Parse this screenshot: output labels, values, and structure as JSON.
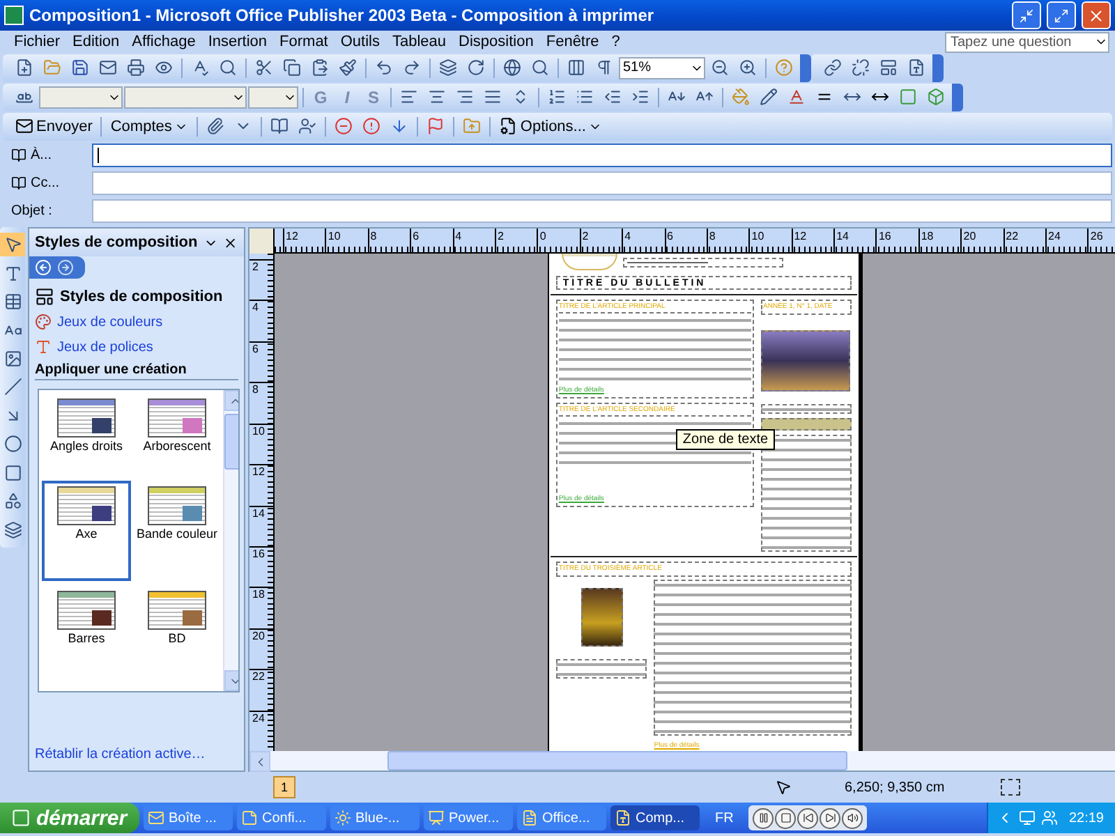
{
  "window": {
    "title": "Composition1 - Microsoft Office Publisher 2003 Beta - Composition à imprimer"
  },
  "menu": [
    "Fichier",
    "Edition",
    "Affichage",
    "Insertion",
    "Format",
    "Outils",
    "Tableau",
    "Disposition",
    "Fenêtre",
    "?"
  ],
  "help_search": {
    "placeholder": "Tapez une question"
  },
  "standard_toolbar": {
    "zoom": "51%"
  },
  "format_toolbar": {
    "style_buttons": [
      "G",
      "I",
      "S"
    ]
  },
  "mail_toolbar": {
    "send": "Envoyer",
    "accounts": "Comptes",
    "options": "Options..."
  },
  "address_fields": [
    {
      "label": "À...",
      "focused": true
    },
    {
      "label": "Cc...",
      "focused": false
    },
    {
      "label": "Objet :",
      "focused": false
    }
  ],
  "task_pane": {
    "title": "Styles de composition",
    "heading": "Styles de composition",
    "links": [
      "Jeux de couleurs",
      "Jeux de polices"
    ],
    "section": "Appliquer une création",
    "designs": [
      {
        "name": "Angles droits",
        "selected": false
      },
      {
        "name": "Arborescent",
        "selected": false
      },
      {
        "name": "Axe",
        "selected": true
      },
      {
        "name": "Bande couleur",
        "selected": false
      },
      {
        "name": "Barres",
        "selected": false
      },
      {
        "name": "BD",
        "selected": false
      }
    ],
    "footer_link": "Rétablir la création active…"
  },
  "rulers": {
    "horizontal": [
      "12",
      "10",
      "8",
      "6",
      "4",
      "2",
      "0",
      "2",
      "4",
      "6",
      "8",
      "10",
      "12",
      "14",
      "16",
      "18",
      "20",
      "22",
      "24",
      "26"
    ],
    "vertical": [
      "2",
      "4",
      "6",
      "8",
      "10",
      "12",
      "14",
      "16",
      "18",
      "20",
      "22",
      "24"
    ]
  },
  "publication": {
    "title": "TITRE DU BULLETIN",
    "date": "ANNÉE 1, N° 1, DATE",
    "main_heading": "TITRE DE L'ARTICLE PRINCIPAL",
    "second_heading": "TITRE DE L'ARTICLE SECONDAIRE",
    "third_heading": "TITRE DU TROISIÈME ARTICLE",
    "more_links": [
      "Plus de détails",
      "Plus de détails",
      "Plus de détails"
    ]
  },
  "tooltip": "Zone de texte",
  "status_bar": {
    "page": "1",
    "position": "6,250; 9,350 cm"
  },
  "taskbar": {
    "start": "démarrer",
    "tasks": [
      {
        "label": "Boîte ...",
        "selected": false
      },
      {
        "label": "Confi...",
        "selected": false
      },
      {
        "label": "Blue-...",
        "selected": false
      },
      {
        "label": "Power...",
        "selected": false
      },
      {
        "label": "Office...",
        "selected": false
      },
      {
        "label": "Comp...",
        "selected": true
      }
    ],
    "language": "FR",
    "clock": "22:19"
  }
}
